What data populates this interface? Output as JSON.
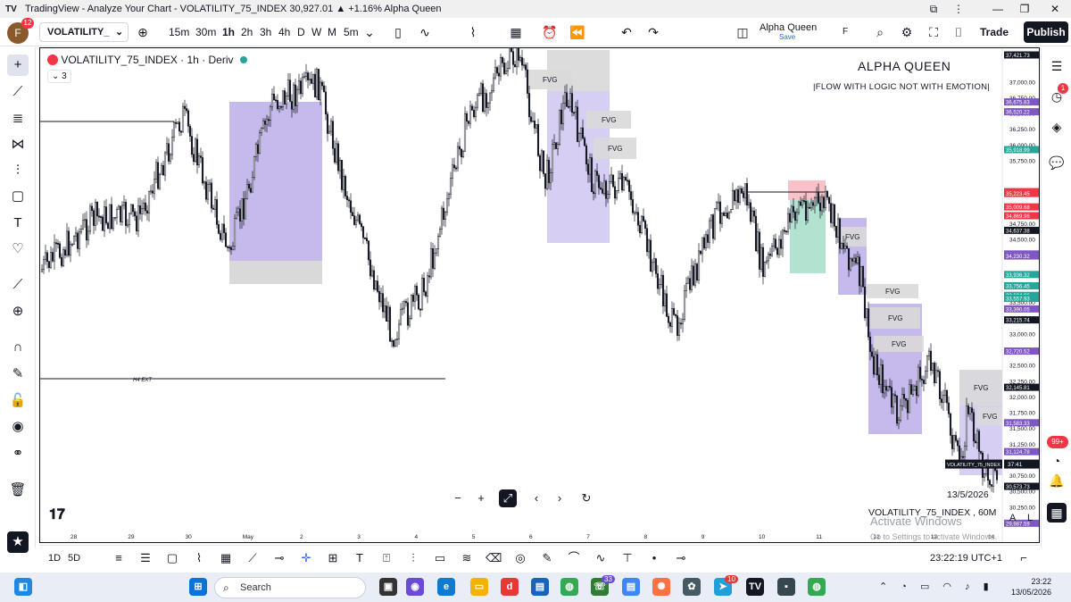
{
  "window": {
    "title": "TradingView - Analyze Your Chart - VOLATILITY_75_INDEX 30,927.01 ▲ +1.16% Alpha Queen",
    "app_name": "TradingView"
  },
  "toolbar": {
    "avatar_letter": "F",
    "avatar_badge": "12",
    "symbol": "VOLATILITY_",
    "intervals": [
      "15m",
      "30m",
      "1h",
      "2h",
      "3h",
      "4h",
      "D",
      "W",
      "M",
      "5m"
    ],
    "active_interval": "1h",
    "layout_name": "Alpha Queen",
    "layout_status": "Save",
    "layout_shortcut": "F",
    "trade_label": "Trade",
    "publish_label": "Publish"
  },
  "chart": {
    "legend_title": "VOLATILITY_75_INDEX · 1h · Deriv",
    "legend_count": "3",
    "watermark_title": "ALPHA QUEEN",
    "watermark_subtitle": "|FLOW WITH LOGIC NOT WITH EMOTION|",
    "date_stamp": "13/5/2026",
    "symbol_footer": "VOLATILITY_75_INDEX , 60M",
    "activate_windows": "Activate Windows",
    "activate_windows_sub": "Go to Settings to activate Windows.",
    "line_label": "H4 EXT",
    "fvg_label": "FVG",
    "current_price_tag": "VOLATILITY_75_INDEX",
    "current_countdown": "37:41",
    "price_scale_mode_a": "A",
    "price_scale_mode_l": "L",
    "accent_color": "#b3a3e6",
    "bear_box_color": "#c9bdf0",
    "green_zone_color": "#9fdcc6",
    "red_zone_color": "#f7b3ba"
  },
  "chart_data": {
    "type": "candlestick",
    "title": "VOLATILITY_75_INDEX · 1h · Deriv",
    "x_ticks": [
      "28",
      "29",
      "30",
      "May",
      "2",
      "3",
      "4",
      "5",
      "6",
      "7",
      "8",
      "9",
      "10",
      "11",
      "12",
      "13",
      "14"
    ],
    "y_ticks": [
      37000,
      36750,
      36500,
      36250,
      36000,
      35750,
      34750,
      34500,
      33500,
      33250,
      33000,
      32750,
      32500,
      32250,
      32000,
      31750,
      31500,
      31250,
      30750,
      30500,
      30250
    ],
    "price_tags": [
      {
        "value": "37,421.73",
        "color": "#131722"
      },
      {
        "value": "36,675.83",
        "color": "#7e57c2"
      },
      {
        "value": "36,520.22",
        "color": "#7e57c2"
      },
      {
        "value": "35,918.99",
        "color": "#26a69a"
      },
      {
        "value": "35,251.73",
        "color": "#f23645"
      },
      {
        "value": "35,223.45",
        "color": "#f23645"
      },
      {
        "value": "35,223.45",
        "color": "#f23645"
      },
      {
        "value": "35,009.68",
        "color": "#f23645"
      },
      {
        "value": "34,869.96",
        "color": "#f23645"
      },
      {
        "value": "34,869.96",
        "color": "#f23645"
      },
      {
        "value": "34,637.38",
        "color": "#131722"
      },
      {
        "value": "34,262.64",
        "color": "#7e57c2"
      },
      {
        "value": "34,230.32",
        "color": "#7e57c2"
      },
      {
        "value": "33,936.32",
        "color": "#26a69a"
      },
      {
        "value": "33,756.45",
        "color": "#26a69a"
      },
      {
        "value": "33,756.45",
        "color": "#26a69a"
      },
      {
        "value": "33,604.86",
        "color": "#26a69a"
      },
      {
        "value": "33,557.93",
        "color": "#26a69a"
      },
      {
        "value": "33,390.05",
        "color": "#7e57c2"
      },
      {
        "value": "33,215.74",
        "color": "#131722"
      },
      {
        "value": "32,720.52",
        "color": "#7e57c2"
      },
      {
        "value": "32,145.81",
        "color": "#131722"
      },
      {
        "value": "31,583.33",
        "color": "#7e57c2"
      },
      {
        "value": "31,124.78",
        "color": "#7e57c2"
      },
      {
        "value": "30,573.73",
        "color": "#131722"
      },
      {
        "value": "29,987.59",
        "color": "#7e57c2"
      }
    ],
    "ylim": [
      29900,
      37500
    ]
  },
  "nav": {
    "zoom_out": "−",
    "zoom_in": "+",
    "reset": "⤢",
    "prev": "‹",
    "next": "›",
    "refresh": "↻"
  },
  "bottom_bar": {
    "range_1d": "1D",
    "range_5d": "5D",
    "clock": "23:22:19 UTC+1"
  },
  "taskbar": {
    "search_placeholder": "Search",
    "time": "23:22",
    "date": "13/05/2026",
    "notif_badge_33": "33",
    "notif_badge_10": "10",
    "right_panel_badge": "1",
    "right_panel_badge2": "99+"
  }
}
